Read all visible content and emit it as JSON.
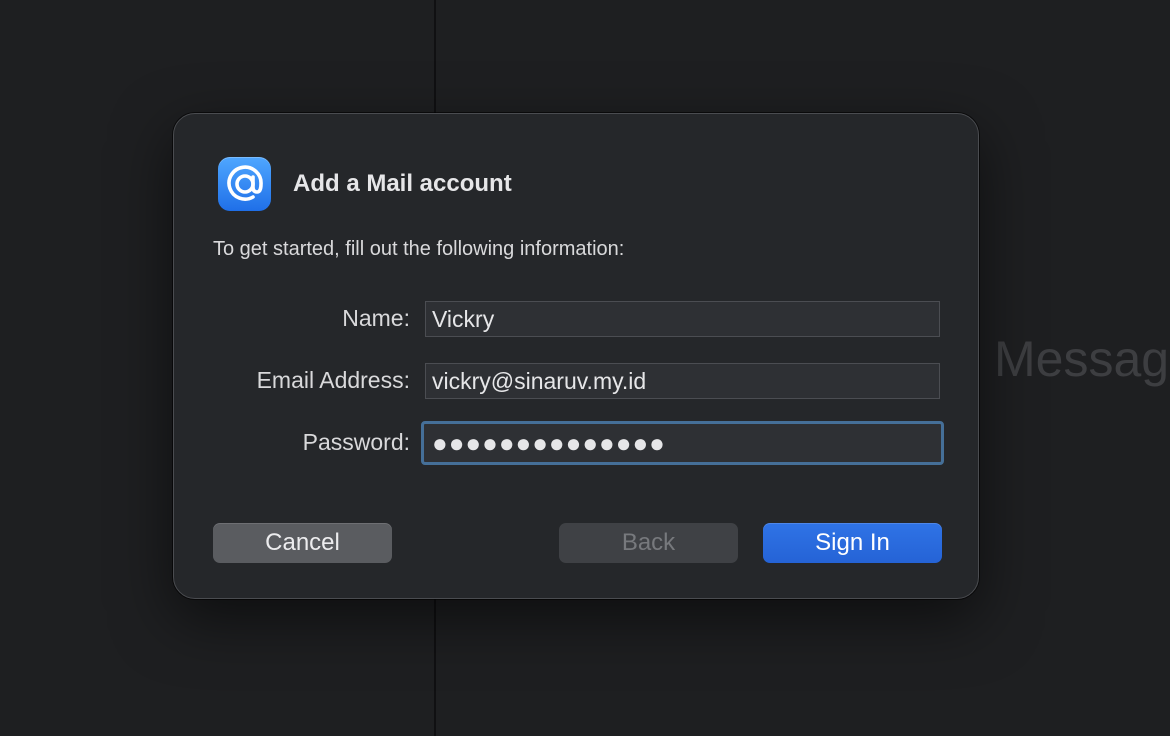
{
  "background": {
    "message_text": "Messag"
  },
  "dialog": {
    "icon": "at-sign-icon",
    "title": "Add a Mail account",
    "subtitle": "To get started, fill out the following information:",
    "fields": {
      "name": {
        "label": "Name:",
        "value": "Vickry"
      },
      "email": {
        "label": "Email Address:",
        "value": "vickry@sinaruv.my.id"
      },
      "password": {
        "label": "Password:",
        "value": "●●●●●●●●●●●●●●"
      }
    },
    "buttons": {
      "cancel": "Cancel",
      "back": "Back",
      "sign_in": "Sign In"
    }
  },
  "colors": {
    "accent": "#2563d6",
    "focus_ring": "#456f98",
    "dialog_bg": "#25272a"
  }
}
